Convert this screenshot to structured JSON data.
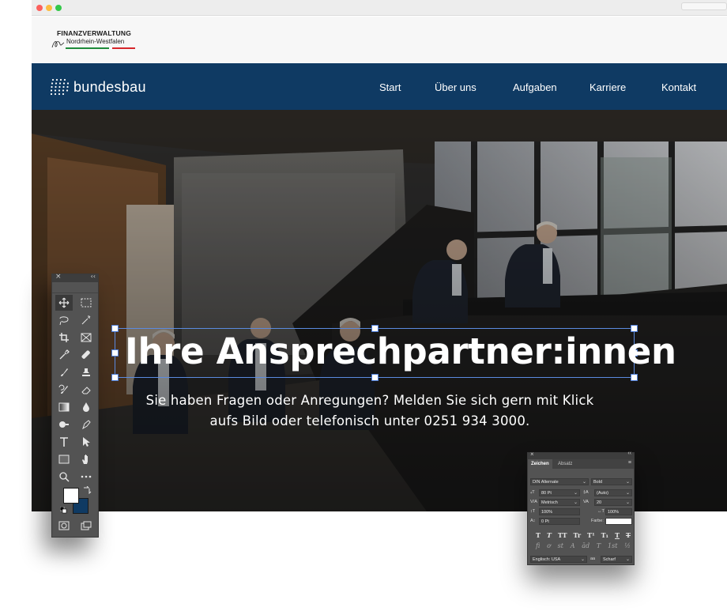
{
  "browser": {
    "controls": [
      "close",
      "minimize",
      "zoom"
    ]
  },
  "topbar": {
    "logo_line1": "FINANZVERWALTUNG",
    "logo_line2": "Nordrhein-Westfalen",
    "colors": {
      "green": "#1f8a3a",
      "red": "#d6262b"
    }
  },
  "navbar": {
    "background": "#0f3a63",
    "brand": "bundesbau",
    "items": [
      {
        "label": "Start"
      },
      {
        "label": "Über uns"
      },
      {
        "label": "Aufgaben"
      },
      {
        "label": "Karriere"
      },
      {
        "label": "Kontakt"
      }
    ]
  },
  "hero": {
    "headline": "Ihre Ansprechpartner:innen",
    "subline_1": "Sie haben Fragen oder Anregungen? Melden Sie sich gern mit Klick",
    "subline_2": "aufs Bild oder telefonisch unter 0251 934 3000."
  },
  "tools_panel": {
    "foreground_color": "#ffffff",
    "background_color": "#0f3a63",
    "tools": [
      "move-icon",
      "marquee-icon",
      "lasso-icon",
      "magic-wand-icon",
      "crop-icon",
      "frame-icon",
      "eyedropper-icon",
      "healing-brush-icon",
      "brush-icon",
      "stamp-icon",
      "history-brush-icon",
      "eraser-icon",
      "gradient-icon",
      "blur-icon",
      "dodge-icon",
      "pen-icon",
      "type-icon",
      "path-select-icon",
      "rectangle-icon",
      "hand-icon",
      "zoom-icon",
      "more-icon"
    ]
  },
  "character_panel": {
    "tabs": [
      "Zeichen",
      "Absatz"
    ],
    "font_family": "DIN Alternate",
    "font_style": "Bold",
    "font_size": "80 Pt",
    "leading": "(Auto)",
    "kerning": "Metrisch",
    "tracking": "20",
    "vertical_scale": "100%",
    "horizontal_scale": "100%",
    "baseline_shift": "0 Pt",
    "color_label": "Farbe:",
    "language": "Englisch: USA",
    "antialias_label": "aa",
    "antialias": "Scharf",
    "glyphs_row1": [
      "T",
      "T",
      "TT",
      "Tr",
      "T¹",
      "T₁",
      "T",
      "T"
    ],
    "glyphs_row2": [
      "fi",
      "ơ",
      "st",
      "A",
      "ād",
      "T",
      "1st",
      "½"
    ]
  }
}
